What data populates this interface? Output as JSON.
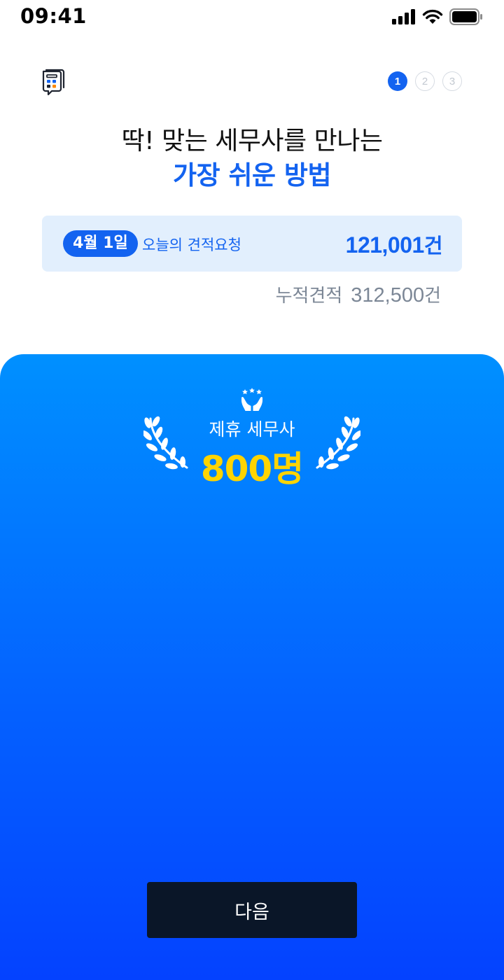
{
  "status_bar": {
    "time": "09:41"
  },
  "stepper": {
    "steps": [
      "1",
      "2",
      "3"
    ],
    "current": 1
  },
  "headline": {
    "line1": "딱! 맞는 세무사를 만나는",
    "line2": "가장 쉬운 방법"
  },
  "stats": {
    "date": "4월 1일",
    "today_label": "오늘의 견적요청",
    "today_count": "121,001",
    "today_unit": "건",
    "total_label": "누적견적",
    "total_count": "312,500",
    "total_unit": "건"
  },
  "badge": {
    "label": "제휴 세무사",
    "count": "800명"
  },
  "next_button": {
    "label": "다음"
  },
  "colors": {
    "primary": "#1363f0",
    "highlight": "#ffd400",
    "button_bg": "#0a1628",
    "card_bg": "#e2effd"
  },
  "icons": [
    "signal-icon",
    "wifi-icon",
    "battery-icon",
    "app-logo-icon",
    "award-hands-icon",
    "laurel-icon"
  ]
}
